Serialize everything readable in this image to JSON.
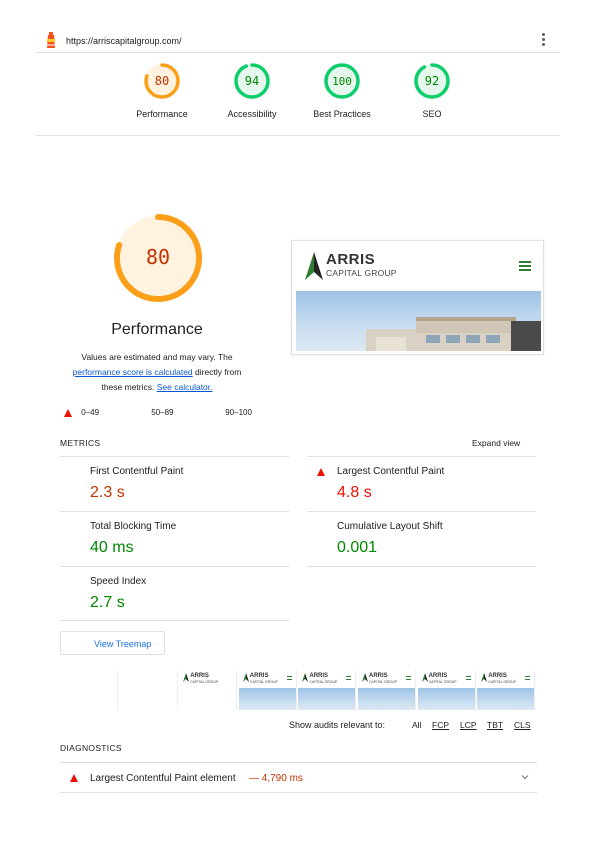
{
  "header": {
    "url": "https://arriscapitalgroup.com/",
    "logo_icon": "lighthouse-icon",
    "menu_icon": "more-vert-icon"
  },
  "summary": [
    {
      "label": "Performance",
      "score": "80",
      "score_fraction": 0.8,
      "color": "#fa9f17"
    },
    {
      "label": "Accessibility",
      "score": "94",
      "score_fraction": 0.94,
      "color": "#0cce6b"
    },
    {
      "label": "Best Practices",
      "score": "100",
      "score_fraction": 1.0,
      "color": "#0cce6b"
    },
    {
      "label": "SEO",
      "score": "92",
      "score_fraction": 0.92,
      "color": "#0cce6b"
    }
  ],
  "performance": {
    "score": "80",
    "score_fraction": 0.8,
    "title": "Performance",
    "desc_1": "Values are estimated and may vary. The",
    "desc_link_1": "performance score is calculated",
    "desc_2": "directly from",
    "desc_3": "these metrics.",
    "desc_link_2": "See calculator.",
    "legend": [
      {
        "range": "0–49",
        "shape": "triangle",
        "color": "#eb0f00"
      },
      {
        "range": "50–89",
        "shape": "square",
        "color": "#fa9f17"
      },
      {
        "range": "90–100",
        "shape": "circle",
        "color": "#0cce6b"
      }
    ]
  },
  "screenshot": {
    "brand": "ARRIS",
    "tagline": "CAPITAL GROUP"
  },
  "metrics": {
    "header": "METRICS",
    "expand_label": "Expand view",
    "items": [
      {
        "name": "First Contentful Paint",
        "value": "2.3 s",
        "rating": "average"
      },
      {
        "name": "Largest Contentful Paint",
        "value": "4.8 s",
        "rating": "fail"
      },
      {
        "name": "Total Blocking Time",
        "value": "40 ms",
        "rating": "pass"
      },
      {
        "name": "Cumulative Layout Shift",
        "value": "0.001",
        "rating": "pass"
      },
      {
        "name": "Speed Index",
        "value": "2.7 s",
        "rating": "pass"
      }
    ]
  },
  "treemap": {
    "label": "View Treemap"
  },
  "filmstrip": {
    "frames": [
      "blank",
      "blank",
      "logo",
      "full",
      "full",
      "full",
      "full",
      "full"
    ],
    "brand": "ARRIS",
    "tagline": "CAPITAL GROUP"
  },
  "filter": {
    "label": "Show audits relevant to:",
    "options": [
      "All",
      "FCP",
      "LCP",
      "TBT",
      "CLS"
    ]
  },
  "diagnostics": {
    "header": "DIAGNOSTICS",
    "items": [
      {
        "name": "Largest Contentful Paint element",
        "value": "— 4,790 ms"
      }
    ]
  }
}
